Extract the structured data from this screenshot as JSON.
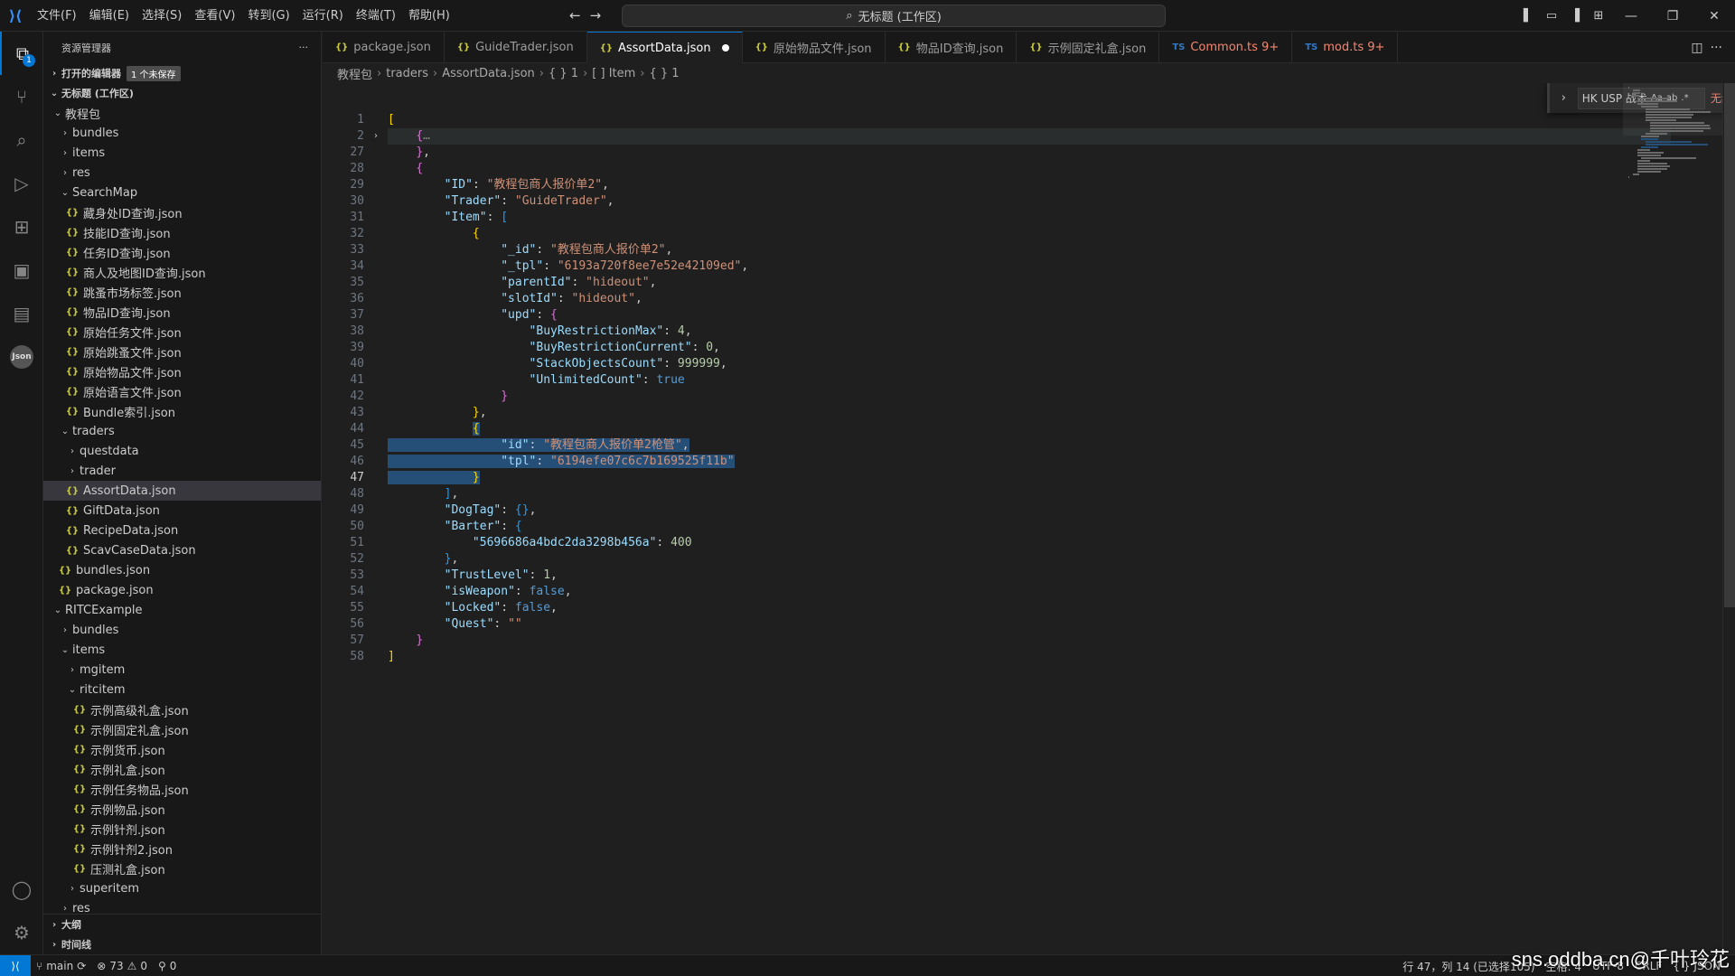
{
  "titlebar": {
    "menu": [
      "文件(F)",
      "编辑(E)",
      "选择(S)",
      "查看(V)",
      "转到(G)",
      "运行(R)",
      "终端(T)",
      "帮助(H)"
    ],
    "command_center": "无标题 (工作区)"
  },
  "activity": {
    "explorer_badge": "1"
  },
  "sidebar": {
    "title": "资源管理器",
    "open_editors": "打开的编辑器",
    "unsaved_badge": "1 个未保存",
    "workspace": "无标题 (工作区)",
    "tree": [
      {
        "label": "教程包",
        "depth": 1,
        "type": "folder-open"
      },
      {
        "label": "bundles",
        "depth": 2,
        "type": "folder"
      },
      {
        "label": "items",
        "depth": 2,
        "type": "folder"
      },
      {
        "label": "res",
        "depth": 2,
        "type": "folder"
      },
      {
        "label": "SearchMap",
        "depth": 2,
        "type": "folder-open"
      },
      {
        "label": "藏身处ID查询.json",
        "depth": 3,
        "type": "file"
      },
      {
        "label": "技能ID查询.json",
        "depth": 3,
        "type": "file"
      },
      {
        "label": "任务ID查询.json",
        "depth": 3,
        "type": "file"
      },
      {
        "label": "商人及地图ID查询.json",
        "depth": 3,
        "type": "file"
      },
      {
        "label": "跳蚤市场标签.json",
        "depth": 3,
        "type": "file"
      },
      {
        "label": "物品ID查询.json",
        "depth": 3,
        "type": "file"
      },
      {
        "label": "原始任务文件.json",
        "depth": 3,
        "type": "file"
      },
      {
        "label": "原始跳蚤文件.json",
        "depth": 3,
        "type": "file"
      },
      {
        "label": "原始物品文件.json",
        "depth": 3,
        "type": "file"
      },
      {
        "label": "原始语言文件.json",
        "depth": 3,
        "type": "file"
      },
      {
        "label": "Bundle索引.json",
        "depth": 3,
        "type": "file"
      },
      {
        "label": "traders",
        "depth": 2,
        "type": "folder-open"
      },
      {
        "label": "questdata",
        "depth": 3,
        "type": "folder"
      },
      {
        "label": "trader",
        "depth": 3,
        "type": "folder"
      },
      {
        "label": "AssortData.json",
        "depth": 3,
        "type": "file",
        "selected": true
      },
      {
        "label": "GiftData.json",
        "depth": 3,
        "type": "file"
      },
      {
        "label": "RecipeData.json",
        "depth": 3,
        "type": "file"
      },
      {
        "label": "ScavCaseData.json",
        "depth": 3,
        "type": "file"
      },
      {
        "label": "bundles.json",
        "depth": 2,
        "type": "file"
      },
      {
        "label": "package.json",
        "depth": 2,
        "type": "file"
      },
      {
        "label": "RITCExample",
        "depth": 1,
        "type": "folder-open"
      },
      {
        "label": "bundles",
        "depth": 2,
        "type": "folder"
      },
      {
        "label": "items",
        "depth": 2,
        "type": "folder-open"
      },
      {
        "label": "mgitem",
        "depth": 3,
        "type": "folder"
      },
      {
        "label": "ritcitem",
        "depth": 3,
        "type": "folder-open"
      },
      {
        "label": "示例高级礼盒.json",
        "depth": 4,
        "type": "file"
      },
      {
        "label": "示例固定礼盒.json",
        "depth": 4,
        "type": "file"
      },
      {
        "label": "示例货币.json",
        "depth": 4,
        "type": "file"
      },
      {
        "label": "示例礼盒.json",
        "depth": 4,
        "type": "file"
      },
      {
        "label": "示例任务物品.json",
        "depth": 4,
        "type": "file"
      },
      {
        "label": "示例物品.json",
        "depth": 4,
        "type": "file"
      },
      {
        "label": "示例针剂.json",
        "depth": 4,
        "type": "file"
      },
      {
        "label": "示例针剂2.json",
        "depth": 4,
        "type": "file"
      },
      {
        "label": "压测礼盒.json",
        "depth": 4,
        "type": "file"
      },
      {
        "label": "superitem",
        "depth": 3,
        "type": "folder"
      },
      {
        "label": "res",
        "depth": 2,
        "type": "folder"
      }
    ],
    "outline": "大纲",
    "timeline": "时间线"
  },
  "tabs": [
    {
      "label": "package.json",
      "kind": "json"
    },
    {
      "label": "GuideTrader.json",
      "kind": "json"
    },
    {
      "label": "AssortData.json",
      "kind": "json",
      "active": true,
      "dirty": true
    },
    {
      "label": "原始物品文件.json",
      "kind": "json"
    },
    {
      "label": "物品ID查询.json",
      "kind": "json"
    },
    {
      "label": "示例固定礼盒.json",
      "kind": "json"
    },
    {
      "label": "Common.ts 9+",
      "kind": "ts",
      "error": true
    },
    {
      "label": "mod.ts 9+",
      "kind": "ts",
      "error": true
    }
  ],
  "breadcrumb": [
    "教程包",
    "traders",
    "AssortData.json",
    "{ } 1",
    "[ ] Item",
    "{ } 1"
  ],
  "find": {
    "query": "HK USP 战术",
    "options": [
      "Aa",
      "ab",
      ".*"
    ],
    "result": "无结果"
  },
  "editor": {
    "current_line": 47,
    "lines": [
      {
        "n": 1,
        "html": "<span class='p1'>[</span>"
      },
      {
        "n": 2,
        "html": "    <span class='p2'>{</span><span style='color:#808080'>…</span>",
        "fold": "›",
        "hl": true
      },
      {
        "n": 27,
        "html": "    <span class='p2'>}</span>,"
      },
      {
        "n": 28,
        "html": "    <span class='p2'>{</span>"
      },
      {
        "n": 29,
        "html": "        <span class='k'>\"ID\"</span>: <span class='s'>\"教程包商人报价单2\"</span>,"
      },
      {
        "n": 30,
        "html": "        <span class='k'>\"Trader\"</span>: <span class='s'>\"GuideTrader\"</span>,"
      },
      {
        "n": 31,
        "html": "        <span class='k'>\"Item\"</span>: <span class='p3'>[</span>"
      },
      {
        "n": 32,
        "html": "            <span class='p1'>{</span>"
      },
      {
        "n": 33,
        "html": "                <span class='k'>\"_id\"</span>: <span class='s'>\"教程包商人报价单2\"</span>,"
      },
      {
        "n": 34,
        "html": "                <span class='k'>\"_tpl\"</span>: <span class='s'>\"6193a720f8ee7e52e42109ed\"</span>,"
      },
      {
        "n": 35,
        "html": "                <span class='k'>\"parentId\"</span>: <span class='s'>\"hideout\"</span>,"
      },
      {
        "n": 36,
        "html": "                <span class='k'>\"slotId\"</span>: <span class='s'>\"hideout\"</span>,"
      },
      {
        "n": 37,
        "html": "                <span class='k'>\"upd\"</span>: <span class='p2'>{</span>"
      },
      {
        "n": 38,
        "html": "                    <span class='k'>\"BuyRestrictionMax\"</span>: <span class='n'>4</span>,"
      },
      {
        "n": 39,
        "html": "                    <span class='k'>\"BuyRestrictionCurrent\"</span>: <span class='n'>0</span>,"
      },
      {
        "n": 40,
        "html": "                    <span class='k'>\"StackObjectsCount\"</span>: <span class='n'>999999</span>,"
      },
      {
        "n": 41,
        "html": "                    <span class='k'>\"UnlimitedCount\"</span>: <span class='b'>true</span>"
      },
      {
        "n": 42,
        "html": "                <span class='p2'>}</span>"
      },
      {
        "n": 43,
        "html": "            <span class='p1'>}</span>,"
      },
      {
        "n": 44,
        "html": "            <span class='sel'><span class='p1'>{</span></span>"
      },
      {
        "n": 45,
        "html": "<span class='sel'>                <span class='k'>\"id\"</span>: <span class='s'>\"教程包商人报价单2枪管\"</span>,</span>"
      },
      {
        "n": 46,
        "html": "<span class='sel'>                <span class='k'>\"tpl\"</span>: <span class='s'>\"6194efe07c6c7b169525f11b\"</span></span>"
      },
      {
        "n": 47,
        "html": "<span class='sel'>            <span class='p1'>}</span></span>"
      },
      {
        "n": 48,
        "html": "        <span class='p3'>]</span>,"
      },
      {
        "n": 49,
        "html": "        <span class='k'>\"DogTag\"</span>: <span class='p3'>{}</span>,"
      },
      {
        "n": 50,
        "html": "        <span class='k'>\"Barter\"</span>: <span class='p3'>{</span>"
      },
      {
        "n": 51,
        "html": "            <span class='k'>\"5696686a4bdc2da3298b456a\"</span>: <span class='n'>400</span>"
      },
      {
        "n": 52,
        "html": "        <span class='p3'>}</span>,"
      },
      {
        "n": 53,
        "html": "        <span class='k'>\"TrustLevel\"</span>: <span class='n'>1</span>,"
      },
      {
        "n": 54,
        "html": "        <span class='k'>\"isWeapon\"</span>: <span class='b'>false</span>,"
      },
      {
        "n": 55,
        "html": "        <span class='k'>\"Locked\"</span>: <span class='b'>false</span>,"
      },
      {
        "n": 56,
        "html": "        <span class='k'>\"Quest\"</span>: <span class='s'>\"\"</span>"
      },
      {
        "n": 57,
        "html": "    <span class='p2'>}</span>"
      },
      {
        "n": 58,
        "html": "<span class='p1'>]</span>"
      }
    ]
  },
  "statusbar": {
    "branch": "main",
    "errors": "73",
    "warnings": "0",
    "ports": "0",
    "position": "行 47，列 14 (已选择105)",
    "spaces": "空格: 4",
    "encoding": "UTF-8",
    "eol": "CRLF",
    "language": "JSON"
  },
  "watermark": "sns.oddba.cn@千叶玲花",
  "colors": {
    "accent": "#0078d4",
    "selection": "#264f78",
    "error": "#f48771"
  }
}
